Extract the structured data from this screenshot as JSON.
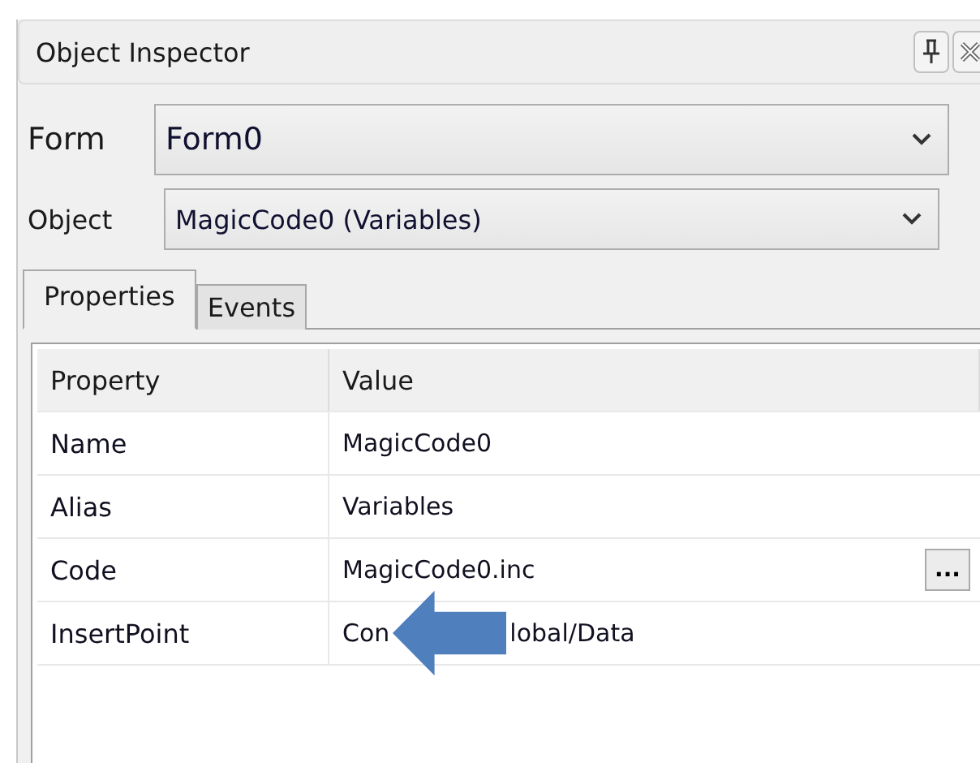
{
  "window": {
    "title": "Object Inspector"
  },
  "selectors": [
    {
      "label": "Form",
      "value": "Form0",
      "kind": "large"
    },
    {
      "label": "Object",
      "value": "MagicCode0 (Variables)",
      "kind": "small"
    }
  ],
  "tabs": [
    {
      "label": "Properties",
      "selected": true
    },
    {
      "label": "Events",
      "selected": false
    }
  ],
  "grid": {
    "columns": [
      "Property",
      "Value"
    ],
    "rows": [
      {
        "name": "Name",
        "value_parts": [
          "MagicCode0"
        ]
      },
      {
        "name": "Alias",
        "value_parts": [
          "Variables"
        ]
      },
      {
        "name": "Code",
        "value_parts": [
          "MagicCode0.inc"
        ],
        "button": "..."
      },
      {
        "name": "InsertPoint",
        "value_parts": [
          "Con",
          "lobal/Data"
        ]
      }
    ]
  }
}
